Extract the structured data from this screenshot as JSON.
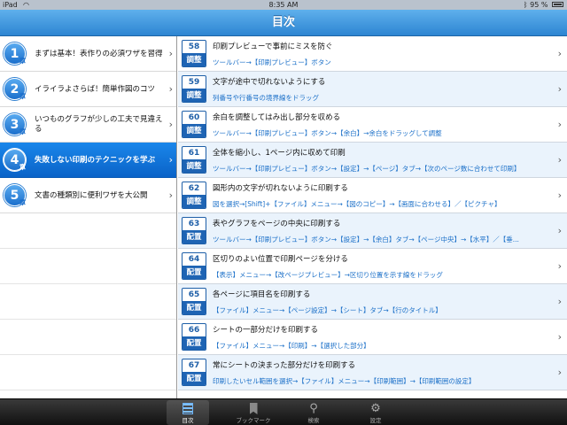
{
  "status": {
    "device": "iPad",
    "time": "8:35 AM",
    "battery": "95 %"
  },
  "titlebar": {
    "title": "目次"
  },
  "chapters": [
    {
      "num": "1",
      "suffix": "章",
      "text": "まずは基本！表作りの必須ワザを習得",
      "selected": false
    },
    {
      "num": "2",
      "suffix": "章",
      "text": "イライラよさらば！簡単作図のコツ",
      "selected": false
    },
    {
      "num": "3",
      "suffix": "章",
      "text": "いつものグラフが少しの工夫で見違える",
      "selected": false
    },
    {
      "num": "4",
      "suffix": "章",
      "text": "失敗しない印刷のテクニックを学ぶ",
      "selected": true
    },
    {
      "num": "5",
      "suffix": "章",
      "text": "文書の種類別に便利ワザを大公開",
      "selected": false
    }
  ],
  "items": [
    {
      "num": "58",
      "cat": "調整",
      "text": "印刷プレビューで事前にミスを防ぐ",
      "sub": "ツールバー→【印刷プレビュー】ボタン"
    },
    {
      "num": "59",
      "cat": "調整",
      "text": "文字が途中で切れないようにする",
      "sub": "列番号や行番号の境界線をドラッグ"
    },
    {
      "num": "60",
      "cat": "調整",
      "text": "余白を調整してはみ出し部分を収める",
      "sub": "ツールバー→【印刷プレビュー】ボタン→【余白】→余白をドラッグして調整"
    },
    {
      "num": "61",
      "cat": "調整",
      "text": "全体を縮小し、1ページ内に収めて印刷",
      "sub": "ツールバー→【印刷プレビュー】ボタン→【設定】→【ページ】タブ→【次のページ数に合わせて印刷】"
    },
    {
      "num": "62",
      "cat": "調整",
      "text": "図形内の文字が切れないように印刷する",
      "sub": "図を選択→[Shift]+【ファイル】メニュー→【図のコピー】→【画面に合わせる】／【ピクチャ】"
    },
    {
      "num": "63",
      "cat": "配置",
      "text": "表やグラフをページの中央に印刷する",
      "sub": "ツールバー→【印刷プレビュー】ボタン→【設定】→【余白】タブ→【ページ中央】→【水平】／【垂..."
    },
    {
      "num": "64",
      "cat": "配置",
      "text": "区切りのよい位置で印刷ページを分ける",
      "sub": "【表示】メニュー→【改ページプレビュー】→区切り位置を示す線をドラッグ"
    },
    {
      "num": "65",
      "cat": "配置",
      "text": "各ページに項目名を印刷する",
      "sub": "【ファイル】メニュー→【ページ設定】→【シート】タブ→【行のタイトル】"
    },
    {
      "num": "66",
      "cat": "配置",
      "text": "シートの一部分だけを印刷する",
      "sub": "【ファイル】メニュー→【印刷】→【選択した部分】"
    },
    {
      "num": "67",
      "cat": "配置",
      "text": "常にシートの決まった部分だけを印刷する",
      "sub": "印刷したいセル範囲を選択→【ファイル】メニュー→【印刷範囲】→【印刷範囲の設定】"
    }
  ],
  "tabs": [
    {
      "label": "目次",
      "icon": "list-icon",
      "active": true
    },
    {
      "label": "ブックマーク",
      "icon": "bookmark-icon",
      "active": false
    },
    {
      "label": "検索",
      "icon": "search-icon",
      "active": false
    },
    {
      "label": "設定",
      "icon": "gear-icon",
      "active": false
    }
  ]
}
